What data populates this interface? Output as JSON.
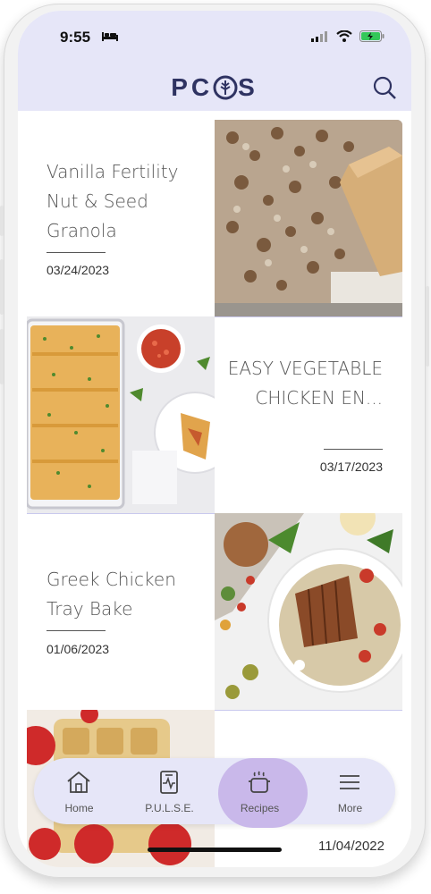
{
  "status_bar": {
    "time": "9:55"
  },
  "header": {
    "logo_text_1": "PC",
    "logo_text_2": "S"
  },
  "recipes": [
    {
      "title": "Vanilla Fertility Nut & Seed Granola",
      "date": "03/24/2023"
    },
    {
      "title": "EASY VEGETABLE CHICKEN EN...",
      "date": "03/17/2023"
    },
    {
      "title": "Greek Chicken Tray Bake",
      "date": "01/06/2023"
    },
    {
      "title": "",
      "date": "11/04/2022"
    }
  ],
  "bottom_nav": {
    "items": [
      {
        "label": "Home",
        "icon": "home-icon"
      },
      {
        "label": "P.U.L.S.E.",
        "icon": "pulse-icon"
      },
      {
        "label": "Recipes",
        "icon": "cooking-pot-icon",
        "active": true
      },
      {
        "label": "More",
        "icon": "menu-icon"
      }
    ]
  },
  "colors": {
    "header_bg": "#e6e6f8",
    "brand": "#2f3362",
    "active_tab": "#c9b8ea",
    "divider": "#c9c9ee"
  }
}
